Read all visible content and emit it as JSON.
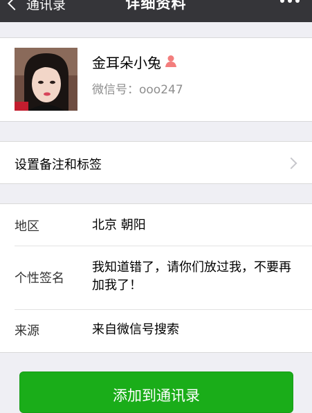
{
  "navbar": {
    "back_label": "通讯录",
    "title": "详细资料",
    "more_icon": "more-icon"
  },
  "profile": {
    "nickname": "金耳朵小兔",
    "gender_icon": "female-icon",
    "gender_color": "#f37e7d",
    "wechat_id": "微信号：ooo247"
  },
  "remark": {
    "label": "设置备注和标签"
  },
  "info": {
    "region_label": "地区",
    "region_value": "北京 朝阳",
    "signature_label": "个性签名",
    "signature_value": "我知道错了，请你们放过我，不要再加我了！",
    "source_label": "来源",
    "source_value": "来自微信号搜索"
  },
  "actions": {
    "add_button": "添加到通讯录"
  },
  "colors": {
    "navbar_bg": "#353539",
    "page_bg": "#efeff4",
    "button_green": "#1aad19"
  }
}
